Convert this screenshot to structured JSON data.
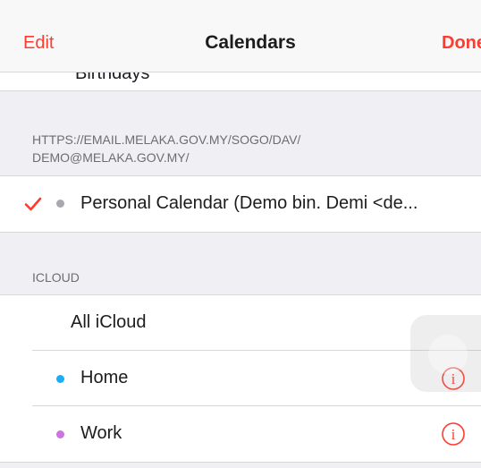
{
  "navbar": {
    "edit_label": "Edit",
    "title": "Calendars",
    "done_label": "Done"
  },
  "partial_row": {
    "text": "Birthdays"
  },
  "sections": {
    "caldav": {
      "header_line1": "HTTPS://EMAIL.MELAKA.GOV.MY/SOGO/DAV/",
      "header_line2": "DEMO@MELAKA.GOV.MY/",
      "items": [
        {
          "label": "Personal Calendar (Demo bin. Demi <de...",
          "checked": true,
          "dot_color": "#a8a8ad"
        }
      ]
    },
    "icloud": {
      "header": "ICLOUD",
      "all_label": "All iCloud",
      "items": [
        {
          "label": "Home",
          "dot_color": "#1aadf8",
          "info_icon": "info-circle-icon"
        },
        {
          "label": "Work",
          "dot_color": "#cc73e1",
          "info_icon": "info-circle-icon"
        }
      ]
    }
  },
  "colors": {
    "accent": "#ff3b30",
    "background": "#efeff4",
    "separator": "#d8d8dc"
  }
}
